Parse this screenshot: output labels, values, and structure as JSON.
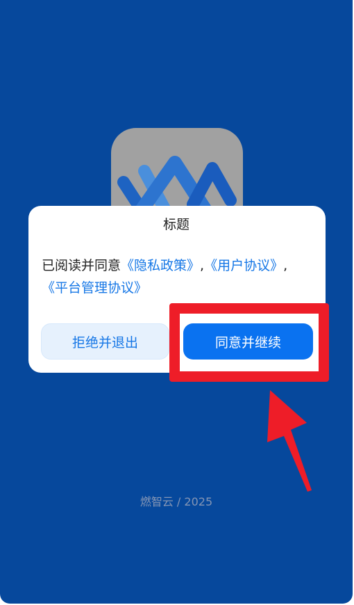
{
  "app": {
    "background_color": "#06489c"
  },
  "logo": {
    "icon": "app-logo-icon",
    "tile_color": "#a1a1a1"
  },
  "dialog": {
    "title": "标题",
    "body": {
      "prefix": "已阅读并同意",
      "privacy_link": "《隐私政策》",
      "sep1": ",",
      "user_link": "《用户协议》",
      "sep2": ",",
      "platform_link": "《平台管理协议》"
    },
    "reject_label": "拒绝并退出",
    "agree_label": "同意并继续",
    "link_color": "#1677e6",
    "accent_color": "#0a72f0"
  },
  "annotation": {
    "color": "#ee1d28"
  },
  "footer": {
    "text": "燃智云 / 2025"
  }
}
